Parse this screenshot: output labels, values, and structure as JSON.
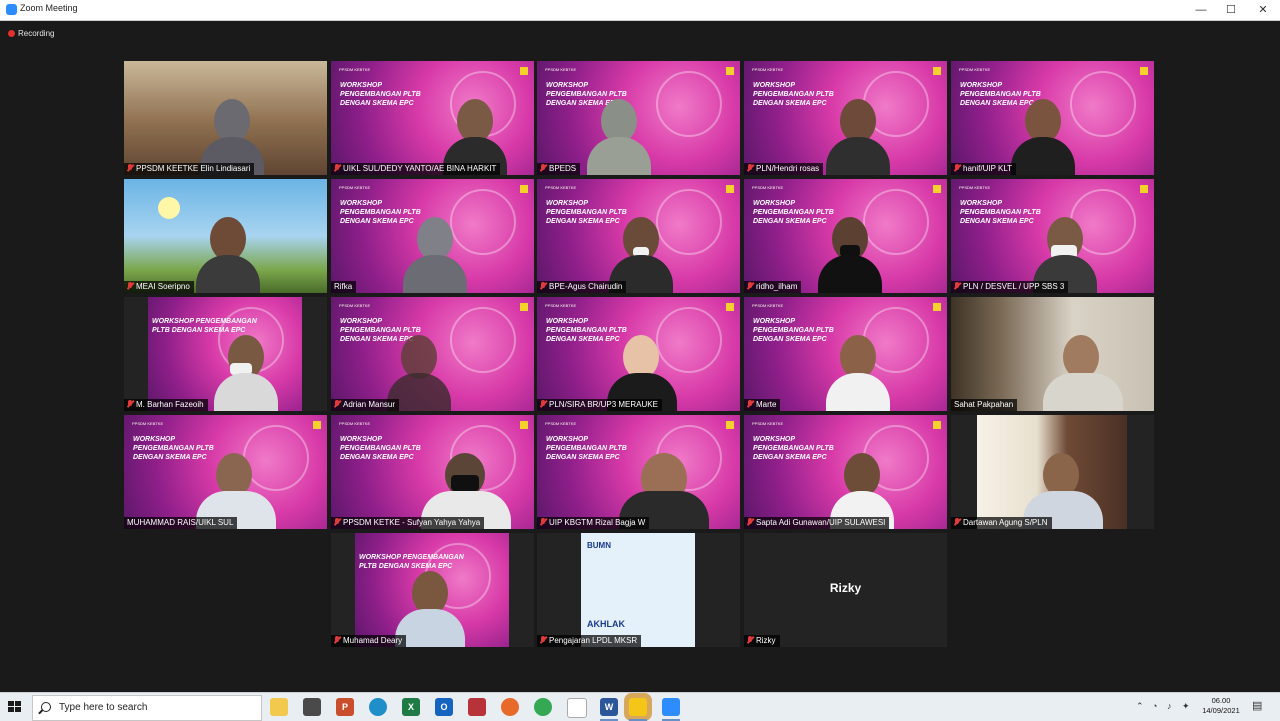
{
  "window": {
    "title": "Zoom Meeting",
    "controls": {
      "minimize": "—",
      "maximize": "☐",
      "close": "✕"
    }
  },
  "recording": "Recording",
  "workshop_text": "WORKSHOP\nPENGEMBANGAN PLTB\nDENGAN SKEMA EPC",
  "brand_text": "PPSDM KEBTKE",
  "participants": [
    {
      "name": "PPSDM KEETKE Elin Lindiasari"
    },
    {
      "name": "UIKL SUL/DEDY YANTO/AE BINA HARKIT"
    },
    {
      "name": "BPEDS"
    },
    {
      "name": "PLN/Hendri rosas"
    },
    {
      "name": "hanif/UIP KLT"
    },
    {
      "name": "MEAI Soeripno"
    },
    {
      "name": "Rifka"
    },
    {
      "name": "BPE-Agus Chairudin"
    },
    {
      "name": "ridho_ilham"
    },
    {
      "name": "PLN / DESVEL / UPP SBS 3"
    },
    {
      "name": "M. Barhan Fazeoih"
    },
    {
      "name": "Adrian Mansur"
    },
    {
      "name": "PLN/SIRA BR/UP3 MERAUKE"
    },
    {
      "name": "Marte"
    },
    {
      "name": "Sahat Pakpahan"
    },
    {
      "name": "MUHAMMAD RAIS/UIKL SUL"
    },
    {
      "name": "PPSDM KETKE - Sufyan Yahya Yahya"
    },
    {
      "name": "UIP KBGTM Rizal Bagja W"
    },
    {
      "name": "Sapta Adi Gunawan/UIP SULAWESI"
    },
    {
      "name": "Dartawan Agung S/PLN"
    },
    {
      "name": "Muhamad Deary"
    },
    {
      "name": "Pengajaran LPDL MKSR"
    },
    {
      "name": "Rizky",
      "display_name": "Rizky"
    }
  ],
  "poster": {
    "logo": "BUMN",
    "text": "AKHLAK"
  },
  "taskbar": {
    "search_placeholder": "Type here to search",
    "time": "06.00",
    "date": "14/09/2021"
  }
}
